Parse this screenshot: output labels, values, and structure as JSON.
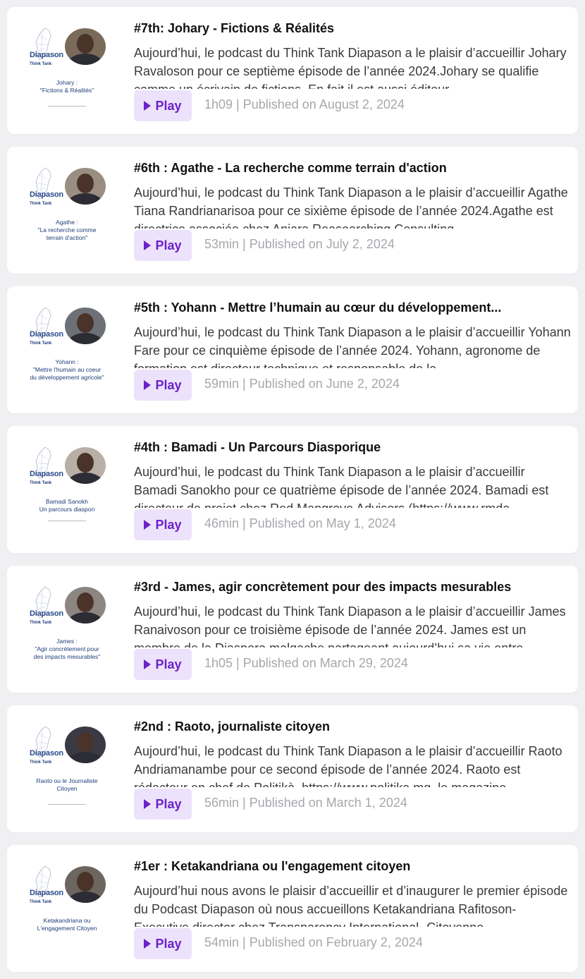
{
  "play_label": "Play",
  "brand_name": "Diapason",
  "brand_tag": "Think Tank",
  "episodes": [
    {
      "title": "#7th: Johary - Fictions & Réalités",
      "description": "Aujourd’hui, le podcast du Think Tank Diapason a le plaisir d’accueillir Johary Ravaloson pour ce septième épisode de l’année 2024.Johary se qualifie comme un écrivain de fictions. En fait il est aussi éditeur",
      "caption": "Johary :\n\"Fictions & Réalités\"",
      "meta": "1h09 | Published on August 2, 2024"
    },
    {
      "title": "#6th : Agathe - La recherche comme terrain d'action",
      "description": "Aujourd’hui, le podcast du Think Tank Diapason a le plaisir d’accueillir Agathe Tiana Randrianarisoa pour ce sixième épisode de l’année 2024.Agathe est directrice associée chez Aniara Reasearching Consulting",
      "caption": "Agathe :\n\"La recherche comme\nterrain d'action\"",
      "meta": "53min | Published on July 2, 2024"
    },
    {
      "title": "#5th : Yohann - Mettre l’humain au cœur du développement...",
      "description": "Aujourd’hui, le podcast du Think Tank Diapason a le plaisir d’accueillir Yohann Fare pour ce cinquième épisode de l’année 2024. Yohann, agronome de formation est directeur technique et responsable de la",
      "caption": "Yohann :\n\"Mettre l'humain au coeur\ndu développement agricole\"",
      "meta": "59min | Published on June 2, 2024"
    },
    {
      "title": "#4th : Bamadi - Un Parcours Diasporique",
      "description": "Aujourd’hui, le podcast du Think Tank Diapason a le plaisir d’accueillir Bamadi Sanokho pour ce quatrième épisode de l’année 2024. Bamadi est directeur de projet chez Red Mangrove Advisors (https://www.rmda-",
      "caption": "Bamadi Sanokh\nUn parcours diaspori",
      "meta": "46min | Published on May 1, 2024"
    },
    {
      "title": "#3rd - James, agir concrètement pour des impacts mesurables",
      "description": "Aujourd’hui, le podcast du Think Tank Diapason a le plaisir d’accueillir James Ranaivoson pour ce troisième épisode de l’année 2024. James est un membre de la Diaspora malgache partageant aujourd’hui sa vie entre",
      "caption": "James :\n\"Agir concrètement pour\ndes impacts mesurables\"",
      "meta": "1h05 | Published on March 29, 2024"
    },
    {
      "title": "#2nd : Raoto, journaliste citoyen",
      "description": "Aujourd’hui, le podcast du Think Tank Diapason a le plaisir d’accueillir Raoto Andriamanambe pour ce second épisode de l’année 2024. Raoto est rédacteur en chef de Politikà, https://www.politika.mg, le magazine",
      "caption": "Raoto ou le Journaliste\nCitoyen",
      "meta": "56min | Published on March 1, 2024"
    },
    {
      "title": "#1er : Ketakandriana ou l'engagement citoyen",
      "description": "Aujourd’hui nous avons le plaisir d’accueillir  et d’inaugurer le premier épisode du Podcast Diapason où nous accueillons Ketakandriana Rafitoson- Executive director chez Transparency International- Citoyenne",
      "caption": "Ketakandriana ou\nL'engagement Citoyen",
      "meta": "54min | Published on February 2, 2024"
    }
  ]
}
